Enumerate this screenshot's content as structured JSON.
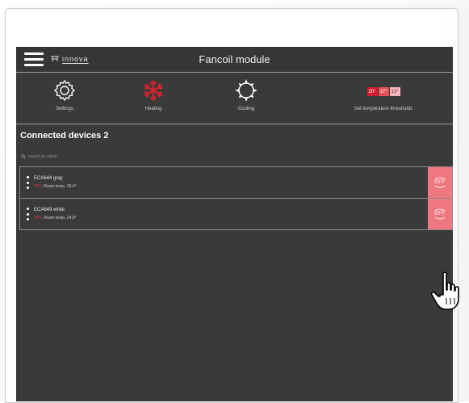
{
  "app": {
    "title": "Fancoil module",
    "logo_text": "innova"
  },
  "modes": [
    {
      "name": "settings",
      "label": "Settings",
      "icon": "gear-icon"
    },
    {
      "name": "heating",
      "label": "Heating",
      "icon": "snowflake-icon",
      "color": "#d4232d"
    },
    {
      "name": "cooling",
      "label": "Cooling",
      "icon": "sun-icon"
    },
    {
      "name": "thresholds",
      "label": "Set temperature thresholds",
      "icon": "temperature-thresholds",
      "values": [
        "20°",
        "17°",
        "13°"
      ],
      "colors": [
        "#d41c2c",
        "#e8515c",
        "#f3b8bc"
      ]
    }
  ],
  "devices_section": {
    "title": "Connected devices 2",
    "search_placeholder": "search by name"
  },
  "devices": [
    {
      "name": "ECA644 gray",
      "state": "OFF",
      "separator": ",",
      "room_temp": "Room temp. 26.4°",
      "button": "OFF"
    },
    {
      "name": "ECA649 white",
      "state": "OFF",
      "separator": ",",
      "room_temp": "Room temp. 24.8°",
      "button": "OFF"
    }
  ],
  "colors": {
    "background": "#3a3a3a",
    "accent_red": "#d4232d",
    "off_button": "#ef7780"
  }
}
